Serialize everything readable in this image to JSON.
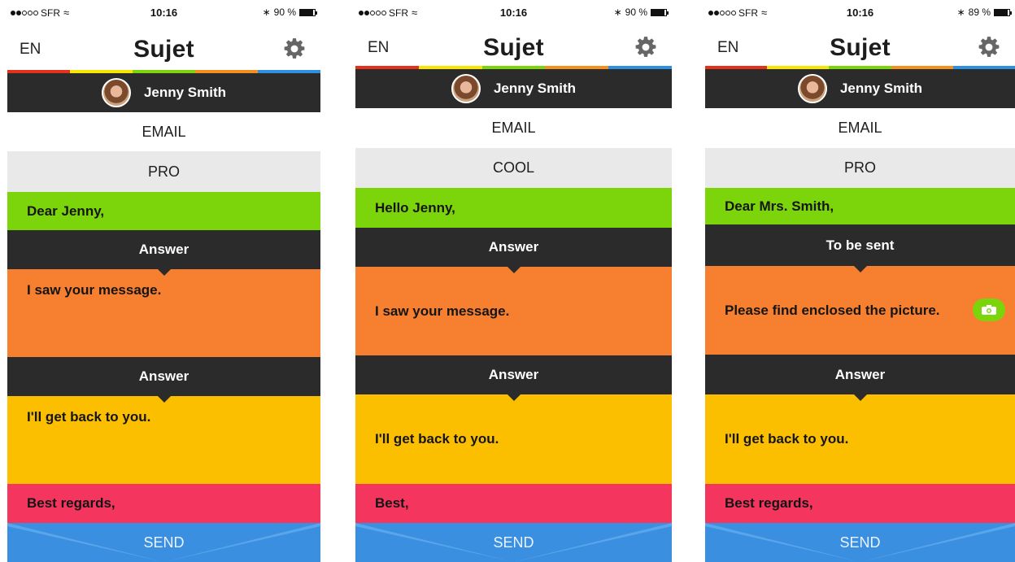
{
  "colors": {
    "stripes": [
      "#e5301b",
      "#f6e600",
      "#7cd50b",
      "#f5901e",
      "#2f8fe0"
    ],
    "greeting": "#7cd50b",
    "orange": "#f67f30",
    "yellow": "#fbbf00",
    "closing": "#f4355d",
    "send": "#3a8fe0",
    "dark": "#2b2b2b"
  },
  "screens": [
    {
      "status": {
        "carrier": "SFR",
        "time": "10:16",
        "battery": "90 %",
        "battery_level": 0.9,
        "signal_bars": 2
      },
      "nav": {
        "lang": "EN",
        "title": "Sujet",
        "settings_icon": "gear-icon"
      },
      "contact": {
        "name": "Jenny Smith"
      },
      "channel": "EMAIL",
      "tone": "PRO",
      "greeting": "Dear Jenny,",
      "section1": "Answer",
      "message1": "I saw your message.",
      "section2": "Answer",
      "message2": "I'll get back to you.",
      "closing": "Best regards,",
      "send": "SEND"
    },
    {
      "status": {
        "carrier": "SFR",
        "time": "10:16",
        "battery": "90 %",
        "battery_level": 0.9,
        "signal_bars": 2
      },
      "nav": {
        "lang": "EN",
        "title": "Sujet",
        "settings_icon": "gear-icon"
      },
      "contact": {
        "name": "Jenny Smith"
      },
      "channel": "EMAIL",
      "tone": "COOL",
      "greeting": "Hello Jenny,",
      "section1": "Answer",
      "message1": "I saw your message.",
      "section2": "Answer",
      "message2": "I'll get back to you.",
      "closing": "Best,",
      "send": "SEND"
    },
    {
      "status": {
        "carrier": "SFR",
        "time": "10:16",
        "battery": "89 %",
        "battery_level": 0.89,
        "signal_bars": 2
      },
      "nav": {
        "lang": "EN",
        "title": "Sujet",
        "settings_icon": "gear-icon"
      },
      "contact": {
        "name": "Jenny Smith"
      },
      "channel": "EMAIL",
      "tone": "PRO",
      "greeting": "Dear Mrs. Smith,",
      "section1": "To be sent",
      "message1": "Please find enclosed the picture.",
      "attachment_icon": "camera-icon",
      "section2": "Answer",
      "message2": "I'll get back to you.",
      "closing": "Best regards,",
      "send": "SEND"
    }
  ]
}
